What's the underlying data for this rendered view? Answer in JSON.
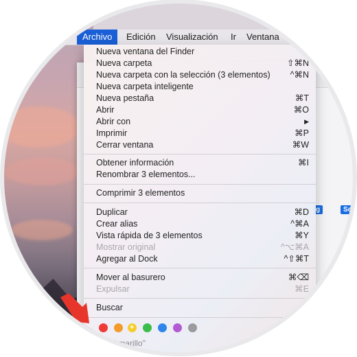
{
  "menubar": {
    "items": [
      {
        "label": "Archivo",
        "active": true
      },
      {
        "label": "Edición",
        "active": false
      },
      {
        "label": "Visualización",
        "active": false
      },
      {
        "label": "Ir",
        "active": false
      },
      {
        "label": "Ventana",
        "active": false
      }
    ]
  },
  "dropdown": {
    "items": [
      {
        "label": "Nueva ventana del Finder",
        "shortcut": "⌘",
        "enabled": true
      },
      {
        "label": "Nueva carpeta",
        "shortcut": "⇧⌘N",
        "enabled": true
      },
      {
        "label": "Nueva carpeta con la selección (3 elementos)",
        "shortcut": "^⌘N",
        "enabled": true
      },
      {
        "label": "Nueva carpeta inteligente",
        "shortcut": "",
        "enabled": true
      },
      {
        "label": "Nueva pestaña",
        "shortcut": "⌘T",
        "enabled": true
      },
      {
        "label": "Abrir",
        "shortcut": "⌘O",
        "enabled": true
      },
      {
        "label": "Abrir con",
        "shortcut": "▶",
        "enabled": true
      },
      {
        "label": "Imprimir",
        "shortcut": "⌘P",
        "enabled": true
      },
      {
        "label": "Cerrar ventana",
        "shortcut": "⌘W",
        "enabled": true
      },
      {
        "label": "Obtener información",
        "shortcut": "⌘I",
        "enabled": true
      },
      {
        "label": "Renombrar 3 elementos...",
        "shortcut": "",
        "enabled": true
      },
      {
        "label": "Comprimir 3 elementos",
        "shortcut": "",
        "enabled": true
      },
      {
        "label": "Duplicar",
        "shortcut": "⌘D",
        "enabled": true
      },
      {
        "label": "Crear alias",
        "shortcut": "^⌘A",
        "enabled": true
      },
      {
        "label": "Vista rápida de 3 elementos",
        "shortcut": "⌘Y",
        "enabled": true
      },
      {
        "label": "Mostrar original",
        "shortcut": "^⌥⌘A",
        "enabled": false
      },
      {
        "label": "Agregar al Dock",
        "shortcut": "^⇧⌘T",
        "enabled": true
      },
      {
        "label": "Mover al basurero",
        "shortcut": "⌘⌫",
        "enabled": true
      },
      {
        "label": "Expulsar",
        "shortcut": "⌘E",
        "enabled": false
      },
      {
        "label": "Buscar",
        "shortcut": "⌘",
        "enabled": true
      }
    ],
    "tags": [
      {
        "name": "red",
        "color": "#ee3b36"
      },
      {
        "name": "orange",
        "color": "#f39a2b"
      },
      {
        "name": "yellow",
        "color": "#f6cc2c",
        "plus": "+"
      },
      {
        "name": "green",
        "color": "#3bbd4a"
      },
      {
        "name": "blue",
        "color": "#2f86ea"
      },
      {
        "name": "purple",
        "color": "#b35bd3"
      },
      {
        "name": "gray",
        "color": "#9b9a9d"
      }
    ],
    "tag_caption": "car \"Amarillo\""
  },
  "finder": {
    "labels": [
      "g",
      "So"
    ]
  },
  "colors": {
    "menu_highlight": "#1a5fd6",
    "arrow": "#e8352c"
  }
}
